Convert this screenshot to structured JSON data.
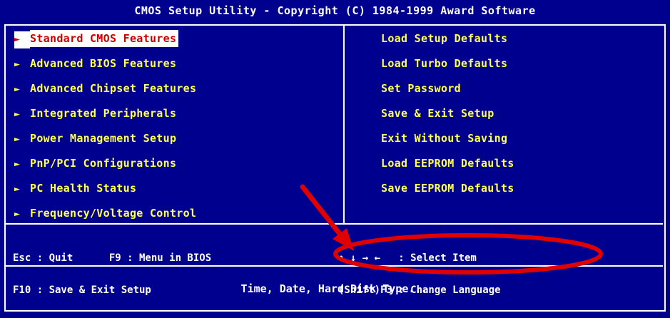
{
  "title": "CMOS Setup Utility - Copyright (C) 1984-1999 Award Software",
  "left_menu": [
    {
      "label": "Standard CMOS Features",
      "selected": true
    },
    {
      "label": "Advanced BIOS Features"
    },
    {
      "label": "Advanced Chipset Features"
    },
    {
      "label": "Integrated Peripherals"
    },
    {
      "label": "Power Management Setup"
    },
    {
      "label": "PnP/PCI Configurations"
    },
    {
      "label": "PC Health Status"
    },
    {
      "label": "Frequency/Voltage Control"
    }
  ],
  "right_menu": [
    {
      "label": "Load Setup Defaults"
    },
    {
      "label": "Load Turbo Defaults"
    },
    {
      "label": "Set Password"
    },
    {
      "label": "Save & Exit Setup"
    },
    {
      "label": "Exit Without Saving"
    },
    {
      "label": "Load EEPROM Defaults"
    },
    {
      "label": "Save EEPROM Defaults"
    }
  ],
  "help": {
    "left_line1": "Esc : Quit      F9 : Menu in BIOS",
    "left_line2": "F10 : Save & Exit Setup",
    "right_line1": "↑ ↓ → ←   : Select Item",
    "right_line2": "(Shift)F3 : Change Language"
  },
  "status_text": "Time, Date, Hard Disk Type...",
  "arrow_glyph": "►",
  "colors": {
    "background": "#00008e",
    "menu_text": "#ffff55",
    "selected_bg": "#ffffff",
    "selected_text": "#c80000",
    "annotation": "#e00000"
  }
}
